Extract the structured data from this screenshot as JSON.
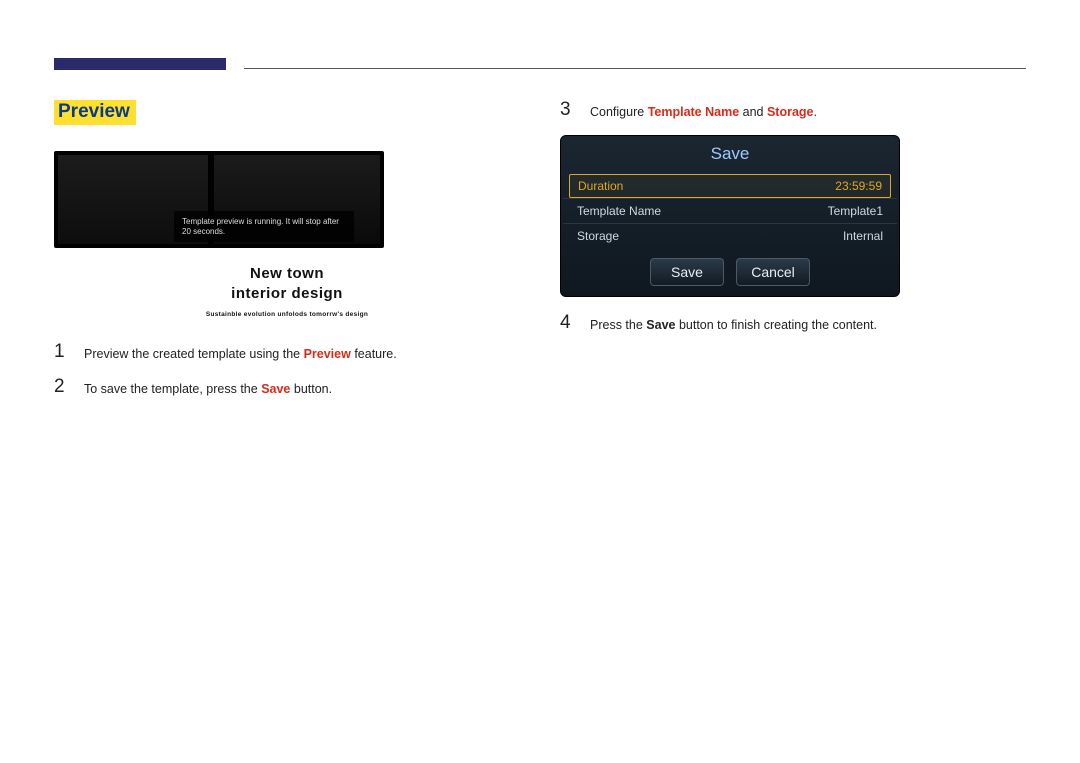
{
  "section_title": "Preview",
  "preview": {
    "toast": "Template preview is running. It will stop after 20 seconds.",
    "caption_line1": "New town",
    "caption_line2": "interior design",
    "subcaption": "Sustainble evolution unfolods tomorrw's design"
  },
  "left_steps": [
    {
      "num": "1",
      "pre": "Preview the created template using the ",
      "hl": "Preview",
      "post": " feature."
    },
    {
      "num": "2",
      "pre": "To save the template, press the ",
      "hl": "Save",
      "post": " button."
    }
  ],
  "right_steps": {
    "step3": {
      "num": "3",
      "pre": "Configure ",
      "hl1": "Template Name",
      "mid": " and ",
      "hl2": "Storage",
      "post": "."
    },
    "step4": {
      "num": "4",
      "pre": "Press the ",
      "hl": "Save",
      "post": " button to finish creating the content."
    }
  },
  "dialog": {
    "title": "Save",
    "rows": {
      "duration": {
        "label": "Duration",
        "value": "23:59:59"
      },
      "template_name": {
        "label": "Template Name",
        "value": "Template1"
      },
      "storage": {
        "label": "Storage",
        "value": "Internal"
      }
    },
    "buttons": {
      "save": "Save",
      "cancel": "Cancel"
    }
  }
}
